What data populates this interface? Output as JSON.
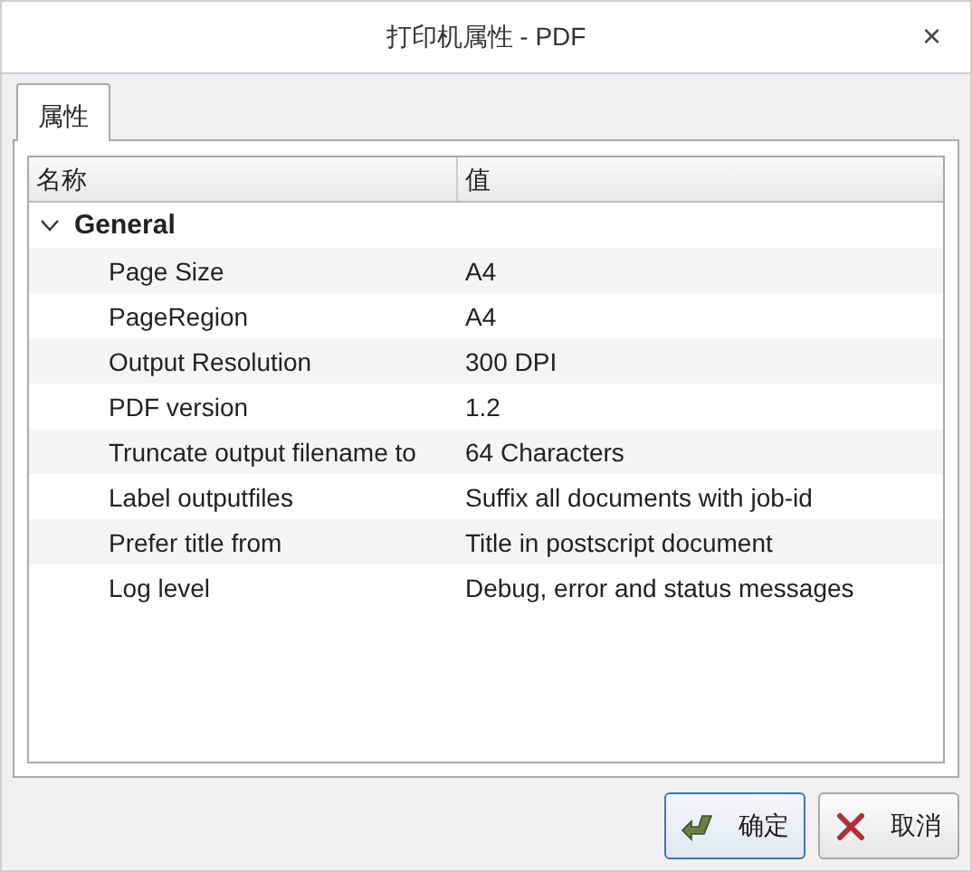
{
  "window": {
    "title": "打印机属性 - PDF",
    "close": "×"
  },
  "tabs": [
    {
      "label": "属性",
      "selected": true
    }
  ],
  "table": {
    "columns": [
      "名称",
      "值"
    ],
    "groups": [
      {
        "name": "General",
        "expanded": true,
        "children": [
          {
            "name": "Page Size",
            "value": "A4"
          },
          {
            "name": "PageRegion",
            "value": "A4"
          },
          {
            "name": "Output Resolution",
            "value": "300 DPI"
          },
          {
            "name": "PDF version",
            "value": "1.2"
          },
          {
            "name": "Truncate output filename to",
            "value": "64 Characters"
          },
          {
            "name": "Label outputfiles",
            "value": "Suffix all documents with job-id"
          },
          {
            "name": "Prefer title from",
            "value": "Title in postscript document"
          },
          {
            "name": "Log level",
            "value": "Debug, error and status messages"
          }
        ]
      }
    ]
  },
  "buttons": [
    {
      "kind": "ok",
      "label": "确定",
      "selected": true
    },
    {
      "kind": "cancel",
      "label": "取消",
      "selected": false
    }
  ]
}
